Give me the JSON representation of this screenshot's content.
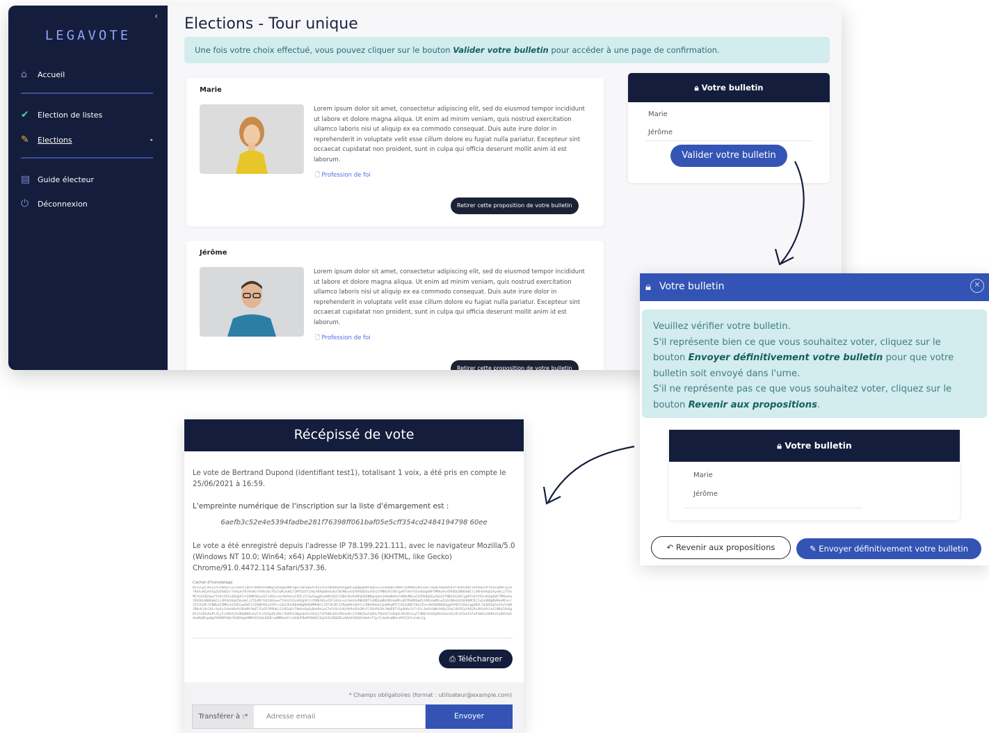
{
  "sidebar": {
    "logo": "LEGAVOTE",
    "collapse_glyph": "‹",
    "items": [
      {
        "label": "Accueil",
        "icon": "home-icon"
      },
      {
        "label": "Election de listes",
        "icon": "check-icon"
      },
      {
        "label": "Elections",
        "icon": "ballot-pen-icon"
      },
      {
        "label": "Guide électeur",
        "icon": "book-icon"
      },
      {
        "label": "Déconnexion",
        "icon": "power-icon"
      }
    ]
  },
  "main": {
    "title": "Elections - Tour unique",
    "info": {
      "before": "Une fois votre choix effectué, vous pouvez cliquer sur le bouton ",
      "bold": "Valider votre bulletin",
      "after": " pour accéder à une page de confirmation."
    },
    "candidates": [
      {
        "name": "Marie",
        "description": "Lorem ipsum dolor sit amet, consectetur adipiscing elit, sed do eiusmod tempor incididunt ut labore et dolore magna aliqua. Ut enim ad minim veniam, quis nostrud exercitation ullamco laboris nisi ut aliquip ex ea commodo consequat. Duis aute irure dolor in reprehenderit in voluptate velit esse cillum dolore eu fugiat nulla pariatur. Excepteur sint occaecat cupidatat non proident, sunt in culpa qui officia deserunt mollit anim id est laborum.",
        "profession_link": "Profession de foi",
        "remove_label": "Retirer cette proposition de votre bulletin"
      },
      {
        "name": "Jérôme",
        "description": "Lorem ipsum dolor sit amet, consectetur adipiscing elit, sed do eiusmod tempor incididunt ut labore et dolore magna aliqua. Ut enim ad minim veniam, quis nostrud exercitation ullamco laboris nisi ut aliquip ex ea commodo consequat. Duis aute irure dolor in reprehenderit in voluptate velit esse cillum dolore eu fugiat nulla pariatur. Excepteur sint occaecat cupidatat non proident, sunt in culpa qui officia deserunt mollit anim id est laborum.",
        "profession_link": "Profession de foi",
        "remove_label": "Retirer cette proposition de votre bulletin"
      }
    ],
    "ballot": {
      "title": "Votre bulletin",
      "names": [
        "Marie",
        "Jérôme"
      ],
      "validate_label": "Valider votre bulletin"
    }
  },
  "modal": {
    "title": "Votre bulletin",
    "message": {
      "line1": "Veuillez vérifier votre bulletin.",
      "p2_before": "S'il représente bien ce que vous souhaitez voter, cliquez sur le bouton ",
      "p2_bold": "Envoyer définitivement votre bulletin",
      "p2_after": " pour que votre bulletin soit envoyé dans l'urne.",
      "p3_before": "S'il ne représente pas ce que vous souhaitez voter, cliquez sur le bouton ",
      "p3_bold": "Revenir aux propositions",
      "p3_after": "."
    },
    "card_title": "Votre bulletin",
    "names": [
      "Marie",
      "Jérôme"
    ],
    "back_label": "Revenir aux propositions",
    "send_label": "Envoyer définitivement votre bulletin"
  },
  "receipt": {
    "title": "Récépissé de vote",
    "vote_text": "Le vote de Bertrand Dupond (identifiant test1), totalisant 1 voix, a été pris en compte le 25/06/2021 à 16:59.",
    "fingerprint_label": "L'empreinte numérique de l'inscription sur la liste d'émargement est :",
    "hash": "6aefb3c52e4e5394fadbe281f76398ff061baf05e5cff354cd2484194798 60ee",
    "ip_text": "Le vote a été enregistré depuis l'adresse IP 78.199.221.111, avec le navigateur Mozilla/5.0 (Windows NT 10.0; Win64; x64) AppleWebKit/537.36 (KHTML, like Gecko) Chrome/91.0.4472.114 Safari/537.36.",
    "signature_title": "Cachet d'horodatage",
    "signature": "MIIGLgYJKoZIhvcNAQcCoIIGHzCCBhsCAQMxDzANBglghkgBZQMEAgEFADCB6wYLKoZIhvcNAQkQAQSggdsEgdgwgdUCAQEGCSsGAQQBs2MBATAxMA0GCWCGSAFlAwQCAQUABCD3f2kQ9vR8c1bXk0wJdYt6aLq9Hh7pZbT4mXcW2yVn5gIUZk8Q2r7xPq3eT0lMnW1sYd9aJ6cYDzIwMjEwNjI1MTQ1OTIzWjADAgEBoGukaTBnMQswCQYDVQQGEwJGUjETMBEGA1UECgwKTGVnYXZvdGUgU0FTMRkwFwYDVQQLDBBUaW1lc3RhbXAgU2VydmljZTEoMCYGA1UEAwwfTGVnYXZvdGUgVGltZXN0YW1wIEF1dGhvcml0eSAxoIIDCjCCAwYwggHuoAMCAQICCQDb7Kx9n0PqGDANBgkqhkiG9w0BAQsFADBnMQswCQYDVQQGEwJGUjETMBEGA1UECgwKTGVnYXZvdGUgU0FTMRkwFwYDVQQLDBBUaW1lc3RhbXAgU2VydmljZTEoMCYGA1UEAwwfTGVnYXZvdGUgVGltZXN0YW1wIEF1dGhvcml0eSAxMB4XDTIxMDEwNDA5MzAwMFoXDTMxMDEwMjA5MzAwMFowZzELMAkGA1UEBhMCRlIxEzARBgNVBAoMCkxlZ2F2b3RlIFNBUzEZMBcGA1UECwwQVGltZXN0YW1wIFNlcnZpY2UxKDAmBgNVBAMMH0xlZ2F2b3RlIFRpbWVzdGFtcCBBdXRob3JpdHkgMTCCASIwDQYJKoZIhvcNAQEBBQADggEPADCCAQoCggEBAL7q3m5Qp9xV2aTnW0fB8cKjHs1dLr4yGvZx6eU0oPiN3wMtYbQ7lEaS5fR9hKc2JuD1gXzT8mVnOq4yBwA0sLpC7eFd3iGtHj9kRu6Xa2MvYl5QnPbZ0c1WdE8TfSg4hKoJx7rUiL3mVtAqNs9eBy2GwCzDf6IpYh0jRvXk5nOt1aSlM8uE4bQgW7cFdZ9xKoPi3LyTe2RmVjHs6NqB0AuYw1fCz5tGp8IxDkr7SbMlE3WgoQn4vJhU2yTaF9dKs6XiP0eLmRc1ZtNb5GwYq8Hv7OkA3fJuD4pEsMiW2xCgTl9B0rVn6QyKbIoUa1HjdFzX5eGtS7wP3mRcL8kN4iEyQ0CAwEAAaMqMCgwDgYDVR0PAQH/BAQDAgbAMBYGA1UdJQEB/wQMMAoGCCsGAQUFBwMIMA0GCSqGSIb3DQEBCwUAA4IBAQCk8mVnT2pJ7xQaRzW0bLd9fE3hYu1oKsCg"
  },
  "receipt_form": {
    "required_note": "* Champs obligatoires (format : utilisateur@example.com)",
    "transfer_label": "Transférer à :*",
    "email_placeholder": "Adresse email",
    "submit_label": "Envoyer",
    "download_label": "Télécharger"
  },
  "colors": {
    "navy": "#141d3b",
    "primary_blue": "#3354b4",
    "info_bg": "#d3ecee",
    "info_text": "#2e6b70"
  }
}
